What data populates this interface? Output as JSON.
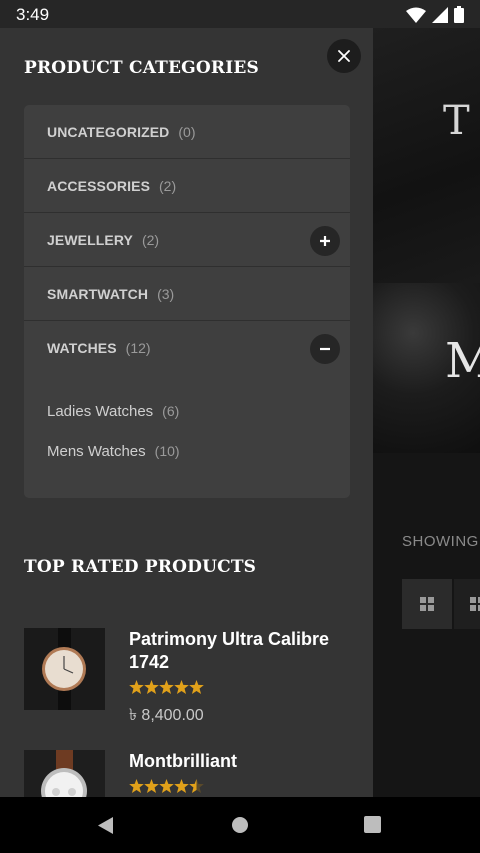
{
  "status_bar": {
    "time": "3:49"
  },
  "drawer": {
    "categories_title": "PRODUCT CATEGORIES",
    "categories": [
      {
        "name": "UNCATEGORIZED",
        "count": "(0)",
        "toggle": ""
      },
      {
        "name": "ACCESSORIES",
        "count": "(2)",
        "toggle": ""
      },
      {
        "name": "JEWELLERY",
        "count": "(2)",
        "toggle": "expand"
      },
      {
        "name": "SMARTWATCH",
        "count": "(3)",
        "toggle": ""
      },
      {
        "name": "WATCHES",
        "count": "(12)",
        "toggle": "collapse"
      }
    ],
    "subcategories": [
      {
        "name": "Ladies Watches",
        "count": "(6)"
      },
      {
        "name": "Mens Watches",
        "count": "(10)"
      }
    ],
    "top_rated_title": "TOP RATED PRODUCTS",
    "products": [
      {
        "name": "Patrimony Ultra Calibre 1742",
        "rating": 5,
        "price": "৳ 8,400.00"
      },
      {
        "name": "Montbrilliant",
        "rating": 4.5,
        "price": ""
      }
    ]
  },
  "background_page": {
    "heading_fragment_1": "T",
    "heading_fragment_2": "M",
    "showing_text": "SHOWING"
  },
  "colors": {
    "star": "#e1a11a",
    "drawer_bg": "#343434",
    "panel_bg": "#3f3f3f"
  },
  "icons": [
    "wifi-icon",
    "signal-icon",
    "battery-icon",
    "close-icon",
    "plus-icon",
    "minus-icon",
    "grid-view-icon",
    "list-view-icon",
    "back-icon",
    "home-icon",
    "recents-icon"
  ]
}
